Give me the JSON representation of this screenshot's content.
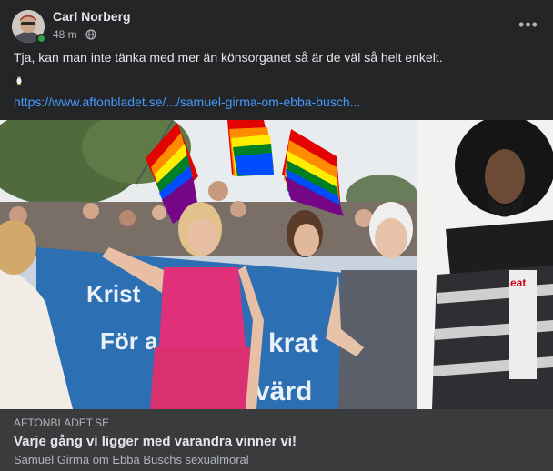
{
  "post": {
    "author": "Carl Norberg",
    "time": "48 m",
    "separator": "·",
    "privacy_icon": "globe-icon",
    "more_icon": "more-options-icon",
    "more_label": "•••",
    "text": "Tja, kan man inte tänka med mer än könsorganet så är de väl så helt enkelt.",
    "emoji_icon": "penguin-emoji-icon",
    "link_text": "https://www.aftonbladet.se/.../samuel-girma-om-ebba-busch..."
  },
  "preview": {
    "domain": "AFTONBLADET.SE",
    "title": "Varje gång vi ligger med varandra vinner vi!",
    "subtitle": "Samuel Girma om Ebba Buschs sexualmoral",
    "image_banner_text": "Kristdemokraterna · För alla · värd",
    "shirt_text": "eat"
  },
  "colors": {
    "background": "#242526",
    "footer": "#3a3b3c",
    "link": "#4599ff",
    "online": "#31a24c"
  }
}
